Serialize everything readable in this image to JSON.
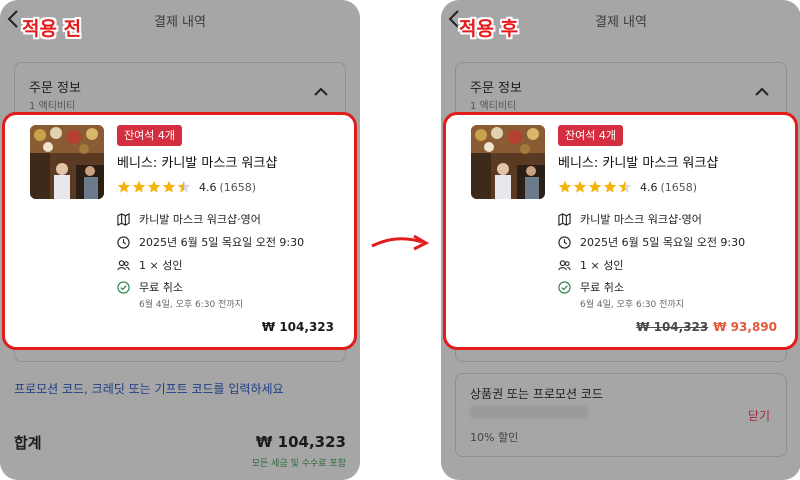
{
  "labels": {
    "before": "적용 전",
    "after": "적용 후"
  },
  "header": {
    "title": "결제 내역"
  },
  "order": {
    "title": "주문 정보",
    "subtitle": "1 액티비티"
  },
  "item": {
    "badge": "잔여석 4개",
    "title": "베니스: 카니발 마스크 워크샵",
    "rating": "4.6",
    "reviews": "(1658)",
    "stars": 4.5,
    "option": "카니발 마스크 워크샵·영어",
    "datetime": "2025년 6월 5일 목요일 오전 9:30",
    "participants": "1 × 성인",
    "cancellation": "무료 취소",
    "cancellation_note": "6월 4일, 오후 6:30 전까지"
  },
  "pricing": {
    "original": "₩ 104,323",
    "discounted": "₩ 93,890"
  },
  "promo": {
    "link_text": "프로모션 코드, 크레딧 또는 기프트 코드를 입력하세요"
  },
  "total": {
    "label": "합계",
    "value": "₩ 104,323",
    "note": "모든 세금 및 수수료 포함"
  },
  "coupon": {
    "title": "상품권 또는 프로모션 코드",
    "discount": "10% 할인",
    "close": "닫기"
  },
  "colors": {
    "accent_red": "#e21b1b",
    "badge": "#d42e40",
    "discount_price": "#e5583a",
    "link": "#1f3e86"
  }
}
